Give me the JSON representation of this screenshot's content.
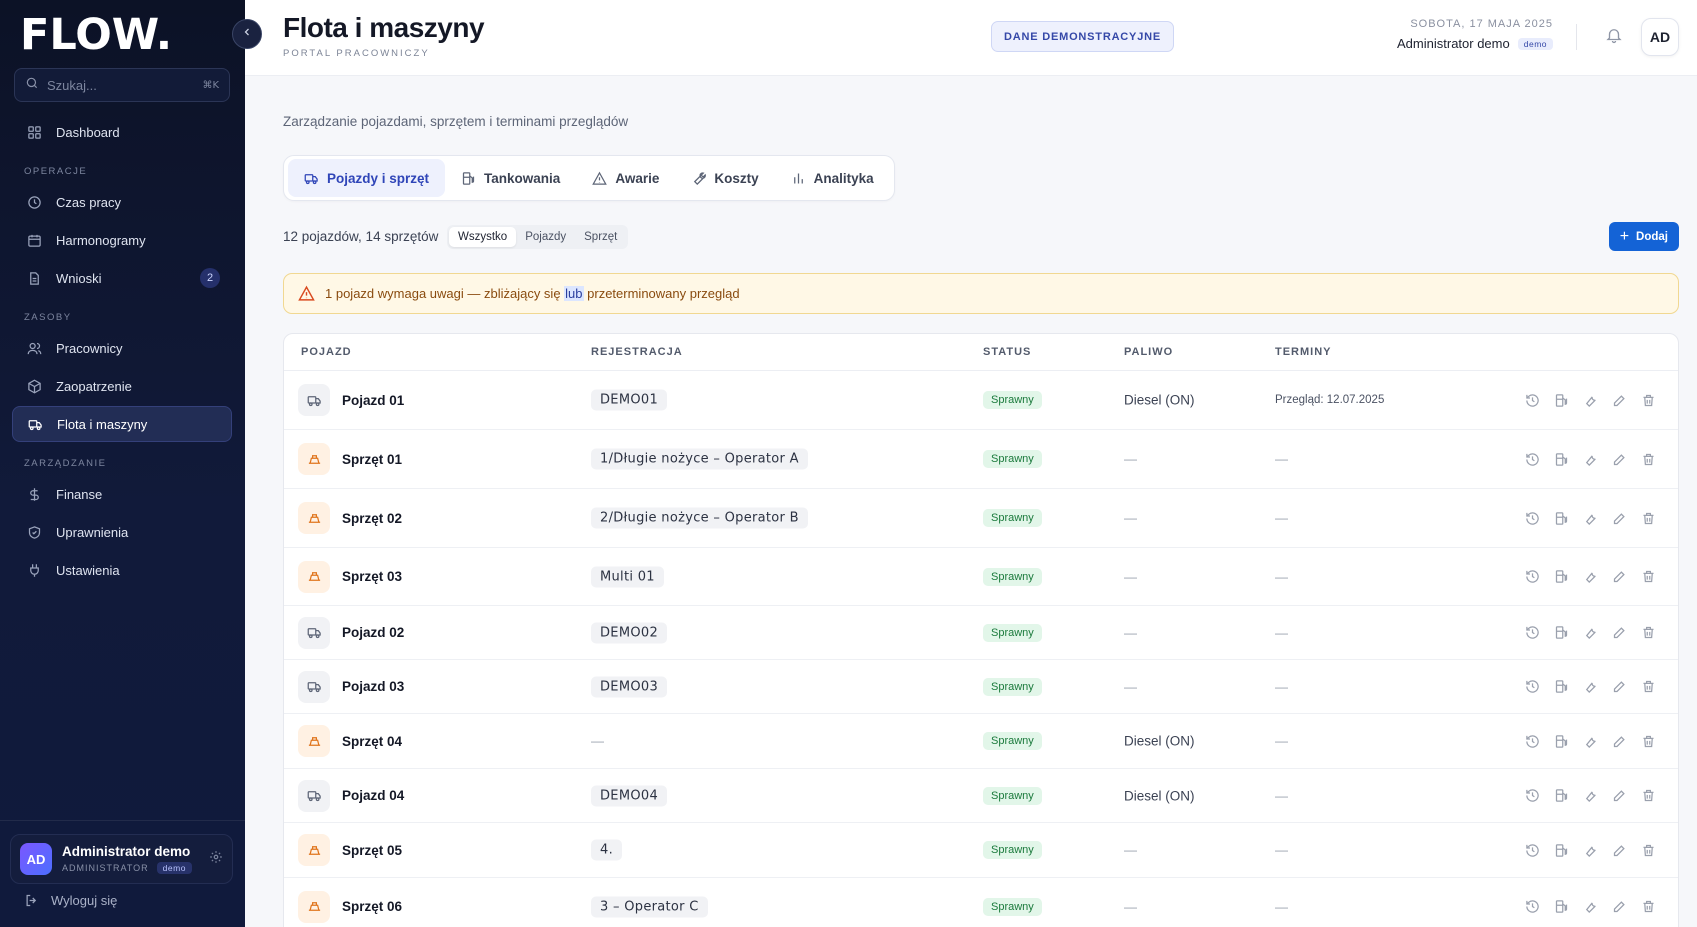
{
  "sidebar": {
    "logo": "FLOW.",
    "search_placeholder": "Szukaj...",
    "search_shortcut": "⌘K",
    "dashboard": "Dashboard",
    "sections": {
      "operations": "OPERACJE",
      "resources": "ZASOBY",
      "management": "ZARZĄDZANIE"
    },
    "items": {
      "work_time": "Czas pracy",
      "schedules": "Harmonogramy",
      "requests": "Wnioski",
      "requests_badge": "2",
      "employees": "Pracownicy",
      "supplies": "Zaopatrzenie",
      "fleet": "Flota i maszyny",
      "finance": "Finanse",
      "permissions": "Uprawnienia",
      "settings": "Ustawienia"
    },
    "user": {
      "initials": "AD",
      "name": "Administrator demo",
      "role": "ADMINISTRATOR",
      "tag": "demo"
    },
    "logout": "Wyloguj się"
  },
  "header": {
    "title": "Flota i maszyny",
    "subtitle": "PORTAL PRACOWNICZY",
    "demo_pill": "DANE DEMONSTRACYJNE",
    "date": "SOBOTA, 17 MAJA 2025",
    "admin_name": "Administrator demo",
    "admin_tag": "demo",
    "avatar": "AD"
  },
  "main": {
    "description": "Zarządzanie pojazdami, sprzętem i terminami przeglądów",
    "tabs": [
      "Pojazdy i sprzęt",
      "Tankowania",
      "Awarie",
      "Koszty",
      "Analityka"
    ],
    "count": "12 pojazdów, 14 sprzętów",
    "filters": [
      "Wszystko",
      "Pojazdy",
      "Sprzęt"
    ],
    "add_button": "Dodaj",
    "alert": {
      "before": "1 pojazd wymaga uwagi — zbliżający się ",
      "highlight": "lub",
      "after": " przeterminowany przegląd"
    }
  },
  "table": {
    "headers": [
      "POJAZD",
      "REJESTRACJA",
      "STATUS",
      "PALIWO",
      "TERMINY"
    ],
    "rows": [
      {
        "type": "vehicle",
        "name": "Pojazd 01",
        "reg": "DEMO01",
        "status": "Sprawny",
        "fuel": "Diesel (ON)",
        "term": "Przegląd: 12.07.2025"
      },
      {
        "type": "equipment",
        "name": "Sprzęt 01",
        "reg": "1/Długie nożyce – Operator A",
        "status": "Sprawny",
        "fuel": "—",
        "term": "—"
      },
      {
        "type": "equipment",
        "name": "Sprzęt 02",
        "reg": "2/Długie nożyce – Operator B",
        "status": "Sprawny",
        "fuel": "—",
        "term": "—"
      },
      {
        "type": "equipment",
        "name": "Sprzęt 03",
        "reg": "Multi 01",
        "status": "Sprawny",
        "fuel": "—",
        "term": "—"
      },
      {
        "type": "vehicle",
        "name": "Pojazd 02",
        "reg": "DEMO02",
        "status": "Sprawny",
        "fuel": "—",
        "term": "—"
      },
      {
        "type": "vehicle",
        "name": "Pojazd 03",
        "reg": "DEMO03",
        "status": "Sprawny",
        "fuel": "—",
        "term": "—"
      },
      {
        "type": "equipment",
        "name": "Sprzęt 04",
        "reg": "—",
        "status": "Sprawny",
        "fuel": "Diesel (ON)",
        "term": "—"
      },
      {
        "type": "vehicle",
        "name": "Pojazd 04",
        "reg": "DEMO04",
        "status": "Sprawny",
        "fuel": "Diesel (ON)",
        "term": "—"
      },
      {
        "type": "equipment",
        "name": "Sprzęt 05",
        "reg": "4.",
        "status": "Sprawny",
        "fuel": "—",
        "term": "—"
      },
      {
        "type": "equipment",
        "name": "Sprzęt 06",
        "reg": "3 – Operator C",
        "status": "Sprawny",
        "fuel": "—",
        "term": "—"
      }
    ],
    "row_actions": [
      "history-icon",
      "fuel-icon",
      "wrench-icon",
      "edit-icon",
      "trash-icon"
    ]
  },
  "colors": {
    "accent": "#1463d6",
    "sidebar_bg": "#0c1226",
    "status_ok": "#1b7a3c",
    "equipment": "#e0741c"
  }
}
